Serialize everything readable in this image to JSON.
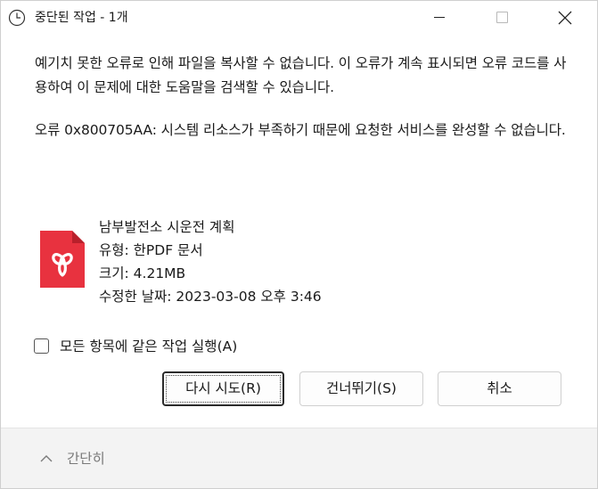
{
  "window": {
    "title": "중단된 작업 - 1개",
    "controls": {
      "minimize": "minimize",
      "maximize": "maximize",
      "close": "close"
    }
  },
  "message": {
    "line1": "예기치 못한 오류로 인해 파일을 복사할 수 없습니다. 이 오류가 계속 표시되면 오류 코드를 사용하여 이 문제에 대한 도움말을 검색할 수 있습니다.",
    "line2": "오류 0x800705AA: 시스템 리소스가 부족하기 때문에 요청한 서비스를 완성할 수 없습니다."
  },
  "file": {
    "icon": "pdf-file-icon",
    "name": "남부발전소 시운전 계획",
    "type": "유형: 한PDF 문서",
    "size": "크기: 4.21MB",
    "modified": "수정한 날짜: 2023-03-08 오후 3:46",
    "icon_color": "#e8323f"
  },
  "checkbox": {
    "label": "모든 항목에 같은 작업 실행(A)",
    "checked": false
  },
  "buttons": {
    "retry": "다시 시도(R)",
    "skip": "건너뛰기(S)",
    "cancel": "취소"
  },
  "footer": {
    "collapse_label": "간단히"
  }
}
